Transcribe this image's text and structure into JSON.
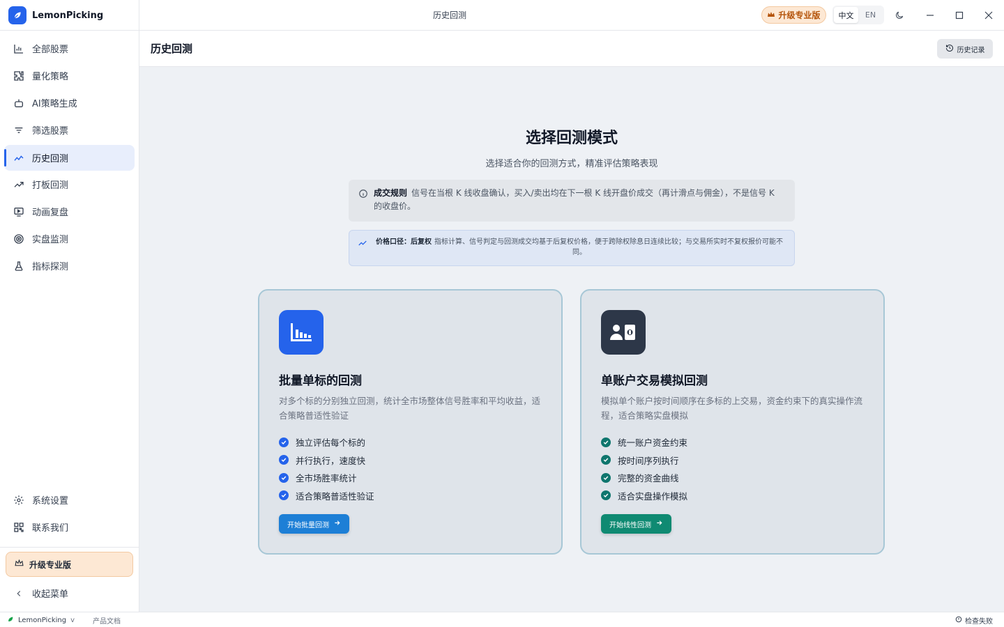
{
  "app": {
    "name": "LemonPicking",
    "window_title": "历史回测"
  },
  "titlebar": {
    "upgrade_label": "升级专业版",
    "lang_zh": "中文",
    "lang_en": "EN"
  },
  "sidebar": {
    "items": [
      {
        "label": "全部股票",
        "icon": "bar-chart-icon"
      },
      {
        "label": "量化策略",
        "icon": "puzzle-icon"
      },
      {
        "label": "AI策略生成",
        "icon": "robot-icon"
      },
      {
        "label": "筛选股票",
        "icon": "filter-icon"
      },
      {
        "label": "历史回测",
        "icon": "line-chart-icon",
        "active": true
      },
      {
        "label": "打板回测",
        "icon": "trending-up-icon"
      },
      {
        "label": "动画复盘",
        "icon": "play-screen-icon"
      },
      {
        "label": "实盘监测",
        "icon": "target-icon"
      },
      {
        "label": "指标探测",
        "icon": "flask-icon"
      }
    ],
    "settings_label": "系统设置",
    "contact_label": "联系我们",
    "upgrade_label": "升级专业版",
    "collapse_label": "收起菜单"
  },
  "page": {
    "title": "历史回测",
    "history_button": "历史记录"
  },
  "hero": {
    "title": "选择回测模式",
    "subtitle": "选择适合你的回测方式，精准评估策略表现"
  },
  "rule": {
    "label": "成交规则",
    "text": "信号在当根 K 线收盘确认，买入/卖出均在下一根 K 线开盘价成交（再计滑点与佣金），不是信号 K 的收盘价。"
  },
  "price": {
    "label": "价格口径：后复权",
    "text": "指标计算、信号判定与回测成交均基于后复权价格，便于跨除权除息日连续比较；与交易所实时不复权报价可能不同。"
  },
  "cards": [
    {
      "title": "批量单标的回测",
      "desc": "对多个标的分别独立回测，统计全市场整体信号胜率和平均收益，适合策略普适性验证",
      "features": [
        "独立评估每个标的",
        "并行执行，速度快",
        "全市场胜率统计",
        "适合策略普适性验证"
      ],
      "button": "开始批量回测",
      "accent": "#2563eb"
    },
    {
      "title": "单账户交易模拟回测",
      "desc": "模拟单个账户按时间顺序在多标的上交易，资金约束下的真实操作流程，适合策略实盘模拟",
      "features": [
        "统一账户资金约束",
        "按时间序列执行",
        "完整的资金曲线",
        "适合实盘操作模拟"
      ],
      "button": "开始线性回测",
      "accent": "#0f766e"
    }
  ],
  "status": {
    "app_name": "LemonPicking",
    "version": "v",
    "docs": "产品文档",
    "check": "检查失败"
  }
}
